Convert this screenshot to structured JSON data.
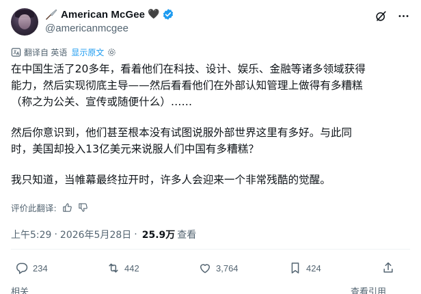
{
  "author": {
    "display_name": "American McGee",
    "heart": "🖤",
    "handle": "@americanmcgee"
  },
  "translation": {
    "label": "翻译自 英语",
    "show_original": "显示原文"
  },
  "tweet": {
    "paragraph_1": "在中国生活了20多年，看着他们在科技、设计、娱乐、金融等诸多领域获得\n能力，然后实现彻底主导——然后看看他们在外部认知管理上做得有多糟糕\n（称之为公关、宣传或随便什么）……",
    "paragraph_2": "然后你意识到，他们甚至根本没有试图说服外部世界这里有多好。与此同\n时，美国却投入13亿美元来说服人们中国有多糟糕？",
    "paragraph_3": "我只知道，当帷幕最终拉开时，许多人会迎来一个非常残酷的觉醒。"
  },
  "rate_translation": "评价此翻译:",
  "meta": {
    "time": "上午5:29",
    "sep": "·",
    "date": "2026年5月28日",
    "views": "25.9万",
    "views_label": "查看"
  },
  "actions": {
    "replies": "234",
    "retweets": "442",
    "likes": "3,764",
    "bookmarks": "424"
  },
  "bottom": {
    "related": "相关",
    "quotes": "查看引用"
  },
  "colors": {
    "accent": "#1d9bf0",
    "secondary_text": "#536471",
    "primary_text": "#0f1419"
  }
}
